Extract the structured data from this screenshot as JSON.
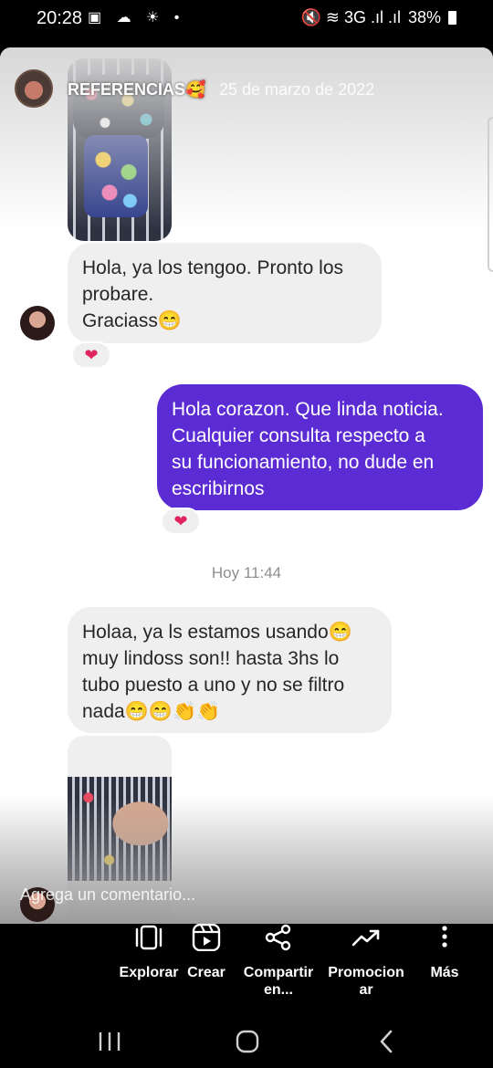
{
  "status_bar": {
    "time": "20:28",
    "left_icons": "▣ ☁ ☀ •",
    "network": "🔇 ≋ 3G .ıl .ıl",
    "battery": "38%"
  },
  "story": {
    "username": "REFERENCIAS🥰",
    "date": "25 de marzo de 2022"
  },
  "messages": [
    {
      "lines": [
        "Hola, ya los tengoo. Pronto los",
        "probare.",
        "Graciass😁"
      ],
      "reaction": "❤"
    },
    {
      "lines": [
        "Hola corazon. Que linda noticia.",
        "Cualquier consulta respecto a",
        "su funcionamiento, no dude en",
        "escribirnos"
      ],
      "reaction": "❤"
    },
    {
      "lines": [
        "Holaa, ya ls estamos usando😁",
        "muy lindoss son!! hasta 3hs lo",
        "tubo puesto a uno y no se filtro",
        "nada😁😁👏👏"
      ]
    }
  ],
  "time_separator": "Hoy 11:44",
  "comment_placeholder": "Agrega un comentario...",
  "toolbar": [
    {
      "label": "Explorar",
      "icon": "explore-icon"
    },
    {
      "label": "Crear",
      "icon": "reels-icon"
    },
    {
      "label_lines": [
        "Compartir",
        "en..."
      ],
      "icon": "share-icon"
    },
    {
      "label_lines": [
        "Promocion",
        "ar"
      ],
      "icon": "trending-icon"
    },
    {
      "label": "Más",
      "icon": "more-icon"
    }
  ],
  "colors": {
    "outgoing_bubble": "#5b2bd4",
    "incoming_bubble": "#efefef",
    "reaction_heart": "#e0245e"
  }
}
